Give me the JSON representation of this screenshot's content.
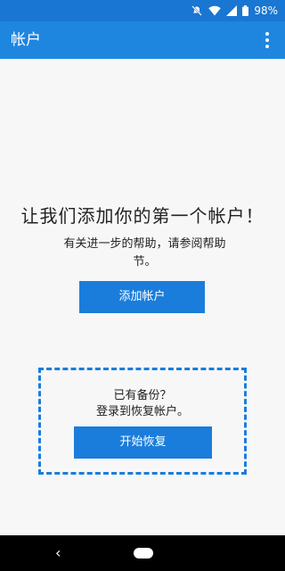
{
  "status_bar": {
    "battery": "98%",
    "icons": [
      "do-not-disturb-icon",
      "wifi-icon",
      "signal-icon",
      "battery-icon"
    ]
  },
  "app_bar": {
    "title": "帐户",
    "menu_icon": "more-vert-icon"
  },
  "main": {
    "headline": "让我们添加你的第一个帐户！",
    "help_text": "有关进一步的帮助，请参阅帮助节。",
    "add_account_button": "添加帐户"
  },
  "restore": {
    "question": "已有备份？",
    "login_text": "登录到恢复帐户。",
    "start_button": "开始恢复"
  },
  "nav_bar": {
    "back_icon": "back-icon",
    "back_glyph": "‹",
    "home_icon": "home-pill-icon"
  },
  "colors": {
    "status_bar": "#1976d2",
    "app_bar": "#1f86e0",
    "accent": "#1a7ddb",
    "background": "#f7f7f7",
    "nav_bar": "#000000"
  }
}
